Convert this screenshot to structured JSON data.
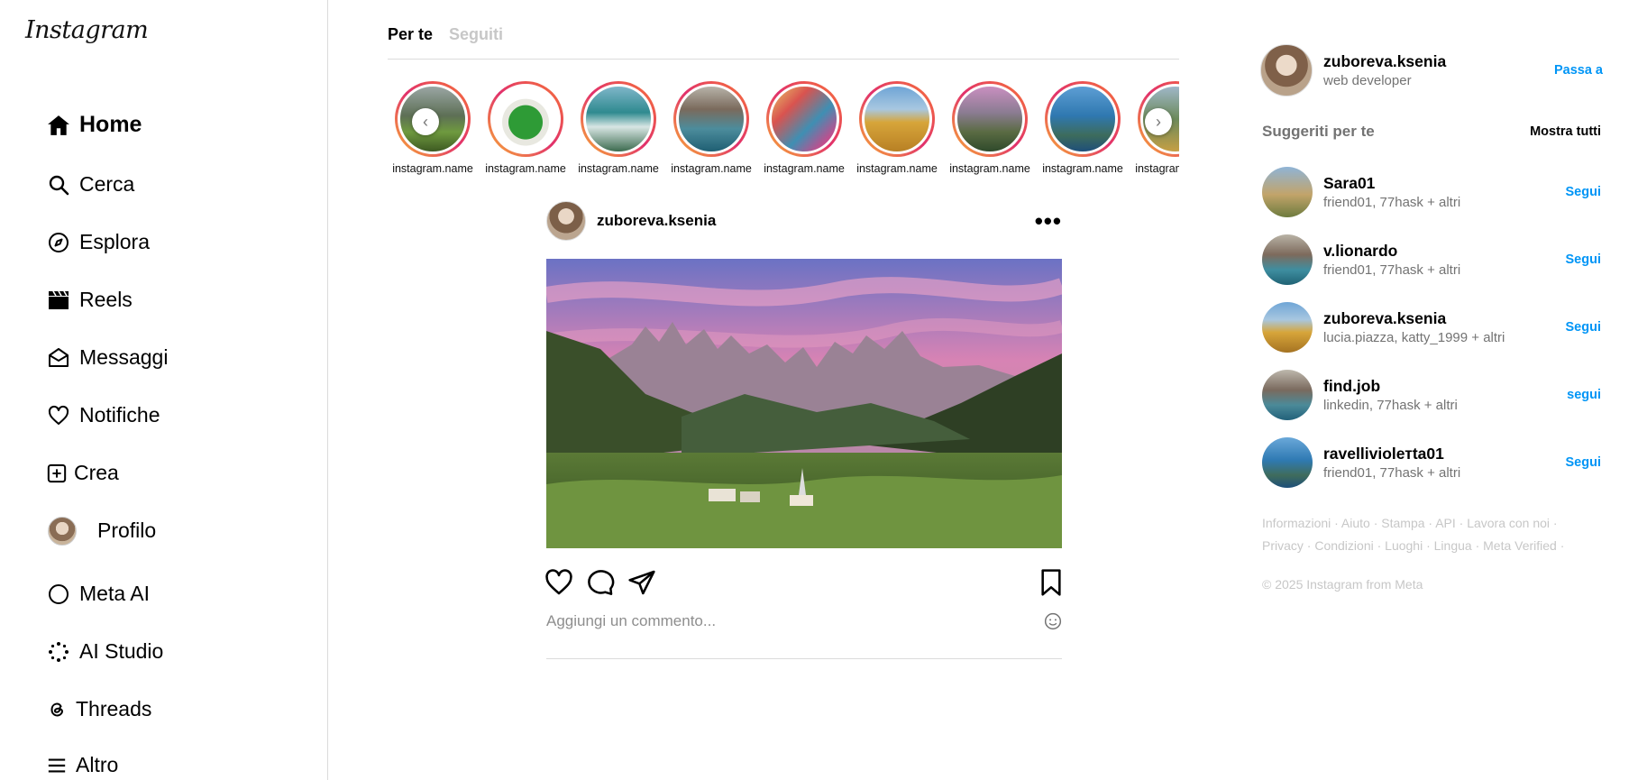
{
  "app": {
    "logo": "Instagram"
  },
  "sidebar": {
    "items": [
      {
        "label": "Home",
        "icon": "home-icon",
        "active": true
      },
      {
        "label": "Cerca",
        "icon": "search-icon"
      },
      {
        "label": "Esplora",
        "icon": "compass-icon"
      },
      {
        "label": "Reels",
        "icon": "clapperboard-icon"
      },
      {
        "label": "Messaggi",
        "icon": "messenger-icon"
      },
      {
        "label": "Notifiche",
        "icon": "heart-icon"
      },
      {
        "label": "Crea",
        "icon": "plus-square-icon"
      },
      {
        "label": "Profilo",
        "icon": "avatar"
      },
      {
        "label": "Meta AI",
        "icon": "meta-ai-ring-icon"
      },
      {
        "label": "AI Studio",
        "icon": "ai-studio-icon"
      },
      {
        "label": "Threads",
        "icon": "threads-icon"
      },
      {
        "label": "Altro",
        "icon": "menu-icon"
      }
    ]
  },
  "feed_tabs": {
    "for_you": "Per te",
    "following": "Seguiti"
  },
  "stories": [
    {
      "name": "instagram.name"
    },
    {
      "name": "instagram.name"
    },
    {
      "name": "instagram.name"
    },
    {
      "name": "instagram.name"
    },
    {
      "name": "instagram.name"
    },
    {
      "name": "instagram.name"
    },
    {
      "name": "instagram.name"
    },
    {
      "name": "instagram.name"
    },
    {
      "name": "instagram.name"
    }
  ],
  "post": {
    "username": "zuboreva.ksenia",
    "more": "•••",
    "comment_placeholder": "Aggiungi un commento..."
  },
  "current_user": {
    "username": "zuboreva.ksenia",
    "subtitle": "web developer",
    "switch": "Passa a"
  },
  "suggestions": {
    "title": "Suggeriti per te",
    "show_all": "Mostra tutti",
    "items": [
      {
        "username": "Sara01",
        "meta": "friend01, 77hask + altri",
        "action": "Segui"
      },
      {
        "username": "v.lionardo",
        "meta": "friend01, 77hask + altri",
        "action": "Segui"
      },
      {
        "username": "zuboreva.ksenia",
        "meta": "lucia.piazza, katty_1999 + altri",
        "action": "Segui"
      },
      {
        "username": "find.job",
        "meta": "linkedin, 77hask + altri",
        "action": "segui"
      },
      {
        "username": "ravelliviolетta01",
        "meta": "friend01, 77hask + altri",
        "action": "Segui"
      }
    ]
  },
  "footer": {
    "line1": "Informazioni · Aiuto · Stampa · API · Lavora con noi ·",
    "line2": "Privacy · Condizioni · Luoghi · Lingua · Meta Verified ·",
    "copyright": "© 2025 Instagram from Meta"
  },
  "colors": {
    "link_blue": "#0095f6",
    "muted": "#737373",
    "border": "#dbdbdb"
  }
}
